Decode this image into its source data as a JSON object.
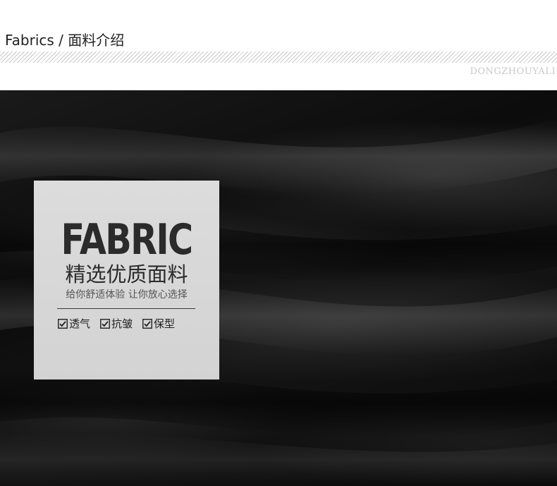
{
  "header": {
    "title": "Fabrics / 面料介绍",
    "brand": "DONGZHOUYALI"
  },
  "card": {
    "heading": "FABRIC",
    "subheading": "精选优质面料",
    "tagline": "给你舒适体验 让你放心选择",
    "features": [
      {
        "label": "透气",
        "icon": "checkbox-checked-icon"
      },
      {
        "label": "抗皱",
        "icon": "checkbox-checked-icon"
      },
      {
        "label": "保型",
        "icon": "checkbox-checked-icon"
      }
    ]
  }
}
